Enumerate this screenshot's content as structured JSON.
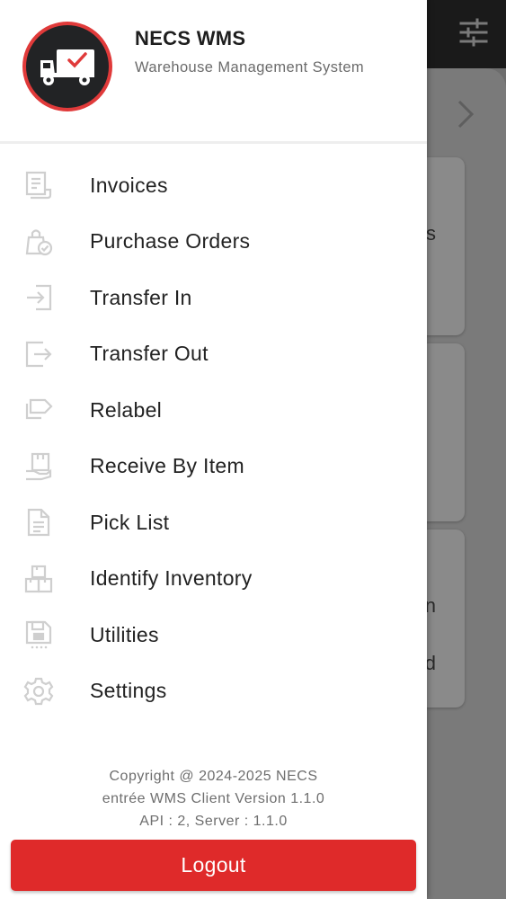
{
  "header": {
    "app_name": "NECS WMS",
    "app_subtitle": "Warehouse Management System"
  },
  "menu": {
    "items": [
      {
        "label": "Invoices",
        "icon": "invoice-icon"
      },
      {
        "label": "Purchase Orders",
        "icon": "purchase-orders-icon"
      },
      {
        "label": "Transfer In",
        "icon": "transfer-in-icon"
      },
      {
        "label": "Transfer Out",
        "icon": "transfer-out-icon"
      },
      {
        "label": "Relabel",
        "icon": "label-icon"
      },
      {
        "label": "Receive By Item",
        "icon": "receive-item-icon"
      },
      {
        "label": "Pick List",
        "icon": "document-icon"
      },
      {
        "label": "Identify Inventory",
        "icon": "boxes-icon"
      },
      {
        "label": "Utilities",
        "icon": "save-icon"
      },
      {
        "label": "Settings",
        "icon": "gear-icon"
      }
    ]
  },
  "footer": {
    "copyright": "Copyright @ 2024-2025 NECS",
    "version": "entrée WMS Client Version 1.1.0",
    "api": "API : 2, Server : 1.1.0"
  },
  "logout_label": "Logout",
  "background": {
    "card_fragments": [
      "s",
      "n",
      "d"
    ]
  },
  "colors": {
    "accent": "#df2a2a",
    "avatar_ring": "#e03a3a",
    "avatar_bg": "#222325",
    "topbar": "#1a1a1a"
  }
}
